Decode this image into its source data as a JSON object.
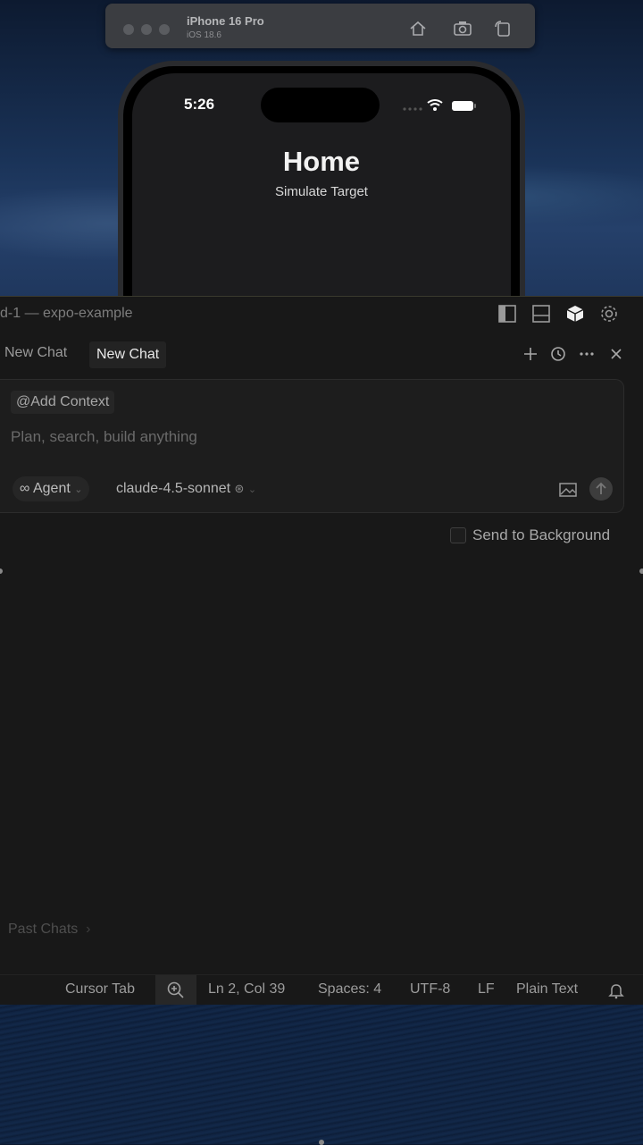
{
  "simulator": {
    "device_name": "iPhone 16 Pro",
    "os_version": "iOS 18.6"
  },
  "phone": {
    "time": "5:26",
    "title": "Home",
    "subtitle": "Simulate Target"
  },
  "editor": {
    "window_title": "d-1 — expo-example",
    "tabs": [
      {
        "label": "New Chat",
        "active": false
      },
      {
        "label": "New Chat",
        "active": true
      }
    ],
    "composer": {
      "add_context_label": "Add Context",
      "placeholder": "Plan, search, build anything",
      "mode_label": "Agent",
      "model_label": "claude-4.5-sonnet"
    },
    "send_to_background_label": "Send to Background",
    "past_chats_label": "Past Chats",
    "statusbar": {
      "cursor_tab": "Cursor Tab",
      "position": "Ln 2, Col 39",
      "spaces": "Spaces: 4",
      "encoding": "UTF-8",
      "line_ending": "LF",
      "language": "Plain Text"
    }
  },
  "colors": {
    "panel_bg": "#181818",
    "composer_bg": "#1d1d1d",
    "text_primary": "#e8e8e8",
    "text_muted": "#9c9c9c"
  }
}
